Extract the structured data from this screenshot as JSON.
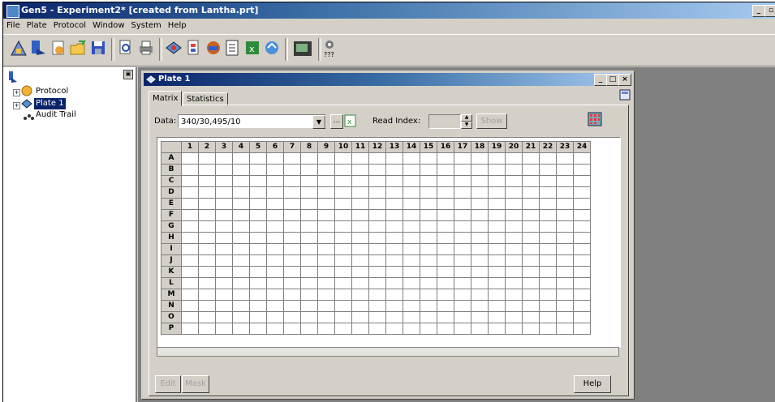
{
  "window": {
    "title": "Gen5 - Experiment2* [created from Lantha.prt]"
  },
  "menu": [
    "File",
    "Plate",
    "Protocol",
    "Window",
    "System",
    "Help"
  ],
  "toolbar": {
    "unknown_label": "???"
  },
  "tree": {
    "items": [
      "Protocol",
      "Plate 1",
      "Audit Trail"
    ]
  },
  "child": {
    "title": "Plate 1"
  },
  "tabs": [
    "Matrix",
    "Statistics"
  ],
  "data_label": "Data:",
  "data_value": "340/30,495/10",
  "read_index_label": "Read Index:",
  "show_button": "Show",
  "more_button": "...",
  "grid": {
    "columns": [
      "1",
      "2",
      "3",
      "4",
      "5",
      "6",
      "7",
      "8",
      "9",
      "10",
      "11",
      "12",
      "13",
      "14",
      "15",
      "16",
      "17",
      "18",
      "19",
      "20",
      "21",
      "22",
      "23",
      "24"
    ],
    "rows": [
      "A",
      "B",
      "C",
      "D",
      "E",
      "F",
      "G",
      "H",
      "I",
      "J",
      "K",
      "L",
      "M",
      "N",
      "O",
      "P"
    ]
  },
  "buttons": {
    "edit": "Edit",
    "mask": "Mask",
    "help": "Help"
  },
  "colors": {
    "titlebar": "#0a246a",
    "face": "#d4d0c8",
    "mdi_bg": "#808080"
  }
}
